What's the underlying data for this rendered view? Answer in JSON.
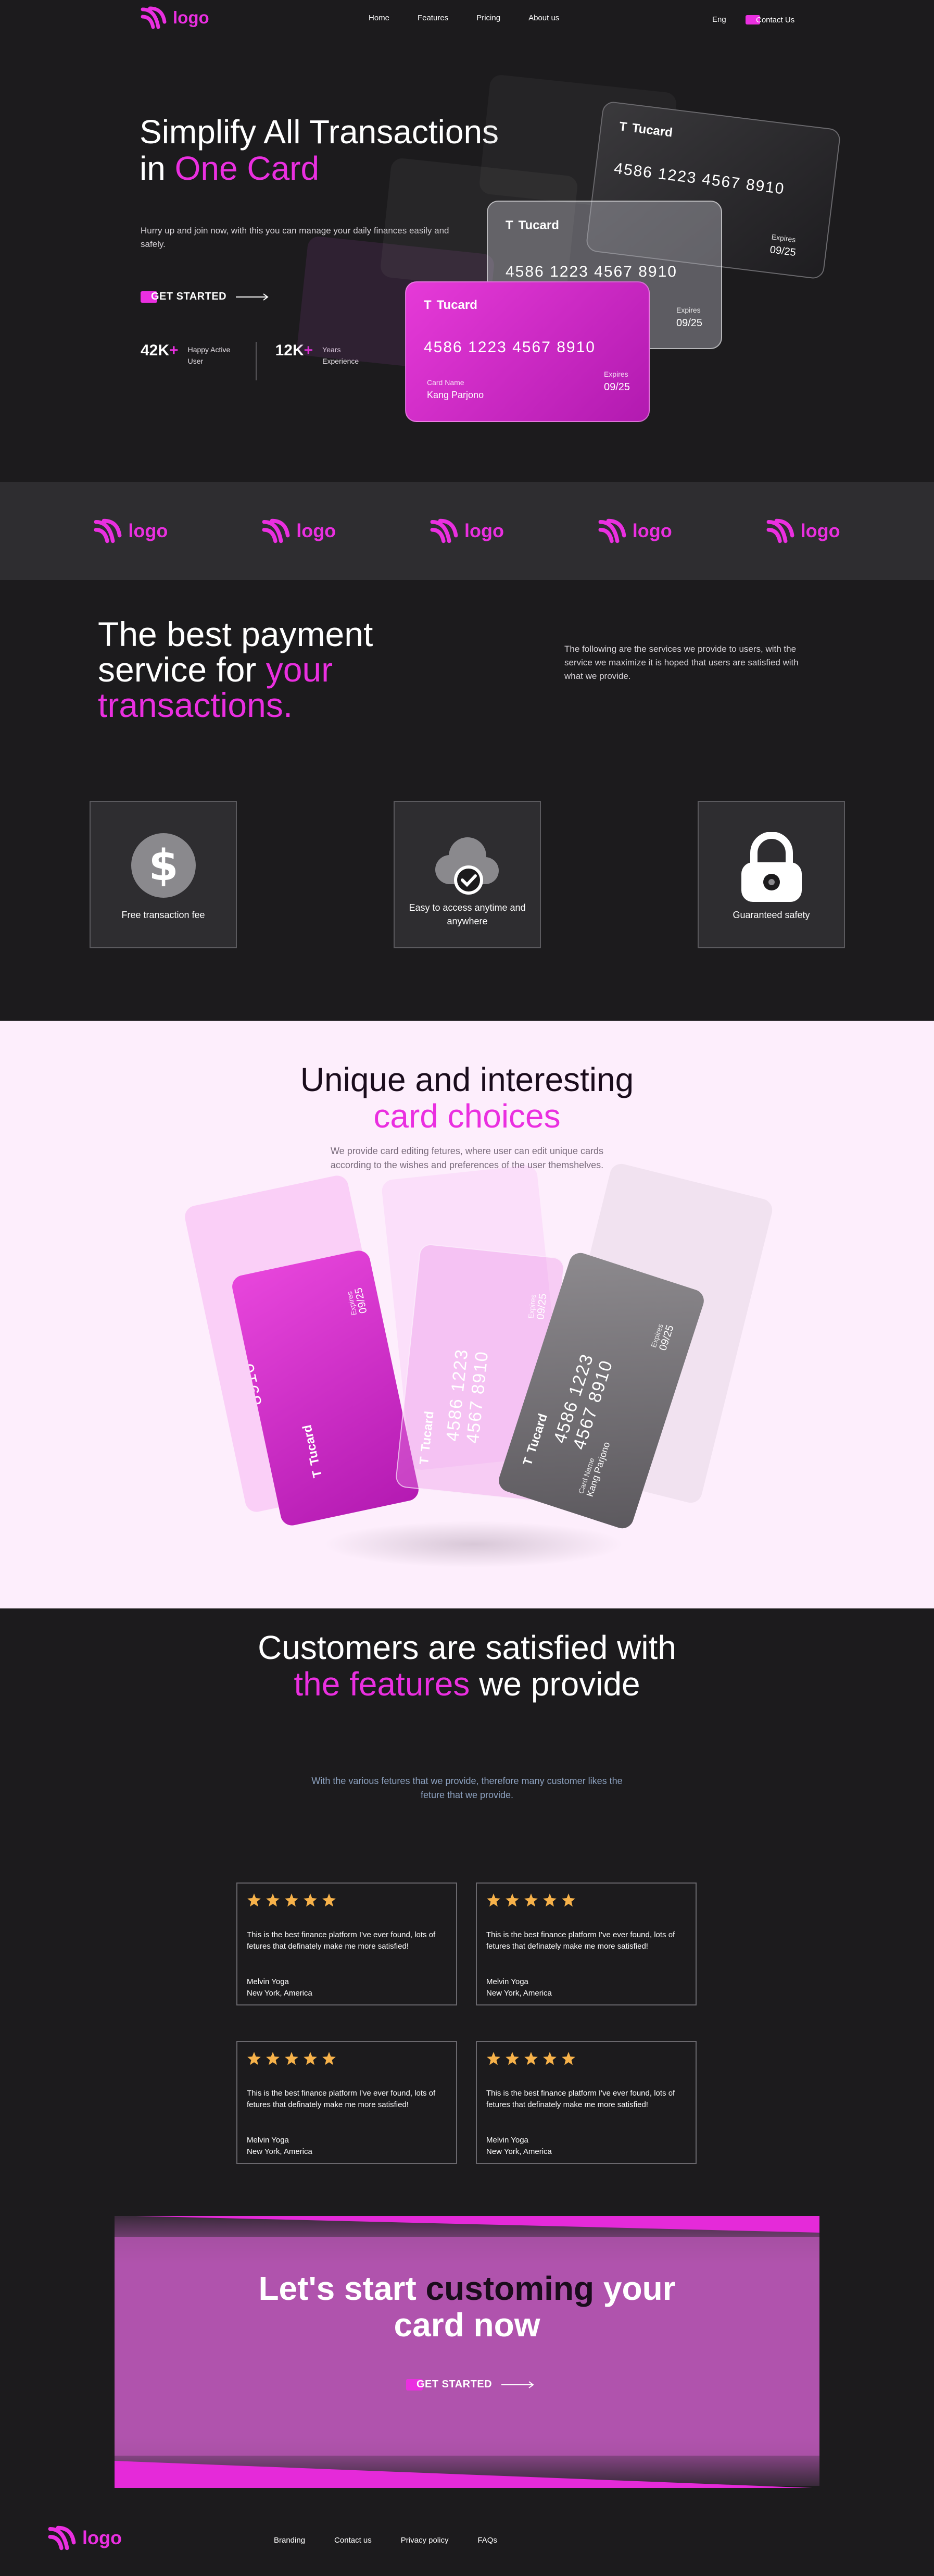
{
  "nav": {
    "logo": "logo",
    "links": [
      "Home",
      "Features",
      "Pricing",
      "About us"
    ],
    "lang": "Eng",
    "contact": "Contact Us"
  },
  "hero": {
    "title_line1": "Simplify All Transactions",
    "title_in": "in ",
    "title_accent": "One Card",
    "subtitle": "Hurry up and join now, with this you can manage your daily finances easily and safely.",
    "cta": "GET STARTED",
    "stats": [
      {
        "value": "42K",
        "plus": "+",
        "label": "Happy Active User"
      },
      {
        "value": "12K",
        "plus": "+",
        "label": "Years Experience"
      }
    ],
    "card": {
      "brand": "Tucard",
      "mark": "T",
      "number": "4586 1223 4567 8910",
      "holder_label": "Card Name",
      "holder": "Kang Parjono",
      "expires_label": "Expires",
      "expires": "09/25"
    }
  },
  "logo_strip": [
    "logo",
    "logo",
    "logo",
    "logo",
    "logo"
  ],
  "services": {
    "title_1": "The best payment",
    "title_2": "service for ",
    "title_accent_1": "your",
    "title_accent_2": "transactions.",
    "description": "The following are the services we provide to users, with the service we maximize it is hoped that users are satisfied with what we provide.",
    "features": [
      {
        "icon": "dollar-icon",
        "label": "Free transaction fee"
      },
      {
        "icon": "cloud-check-icon",
        "label": "Easy to access anytime and anywhere"
      },
      {
        "icon": "lock-icon",
        "label": "Guaranteed safety"
      }
    ]
  },
  "choices": {
    "title_1": "Unique and interesting",
    "title_accent": "card choices",
    "description": "We provide card editing fetures, where user can edit unique cards according to the wishes and preferences of the user themshelves."
  },
  "testimonials": {
    "title_1": "Customers are satisfied with",
    "title_accent": "the features",
    "title_2": " we provide",
    "subtitle": "With the various fetures that we provide, therefore many customer likes the feture that we provide.",
    "reviews": [
      {
        "rating": 5,
        "quote": "This is the best finance platform I've ever found, lots of fetures that definately make me more satisfied!",
        "name": "Melvin Yoga",
        "location": "New York, America"
      },
      {
        "rating": 5,
        "quote": "This is the best finance platform I've ever found, lots of fetures that definately make me more satisfied!",
        "name": "Melvin Yoga",
        "location": "New York, America"
      },
      {
        "rating": 5,
        "quote": "This is the best finance platform I've ever found, lots of fetures that definately make me more satisfied!",
        "name": "Melvin Yoga",
        "location": "New York, America"
      },
      {
        "rating": 5,
        "quote": "This is the best finance platform I've ever found, lots of fetures that definately make me more satisfied!",
        "name": "Melvin Yoga",
        "location": "New York, America"
      }
    ]
  },
  "cta": {
    "title_1": "Let's start ",
    "title_accent": "customing",
    "title_2": " your",
    "title_3": "card now",
    "button": "GET STARTED"
  },
  "footer": {
    "logo": "logo",
    "links": [
      "Branding",
      "Contact us",
      "Privacy policy",
      "FAQs"
    ]
  },
  "colors": {
    "accent": "#ea2fe0",
    "background": "#1c1b1d",
    "panel": "#2e2d30",
    "light_section": "#fdeefc",
    "star": "#f7b24a"
  }
}
